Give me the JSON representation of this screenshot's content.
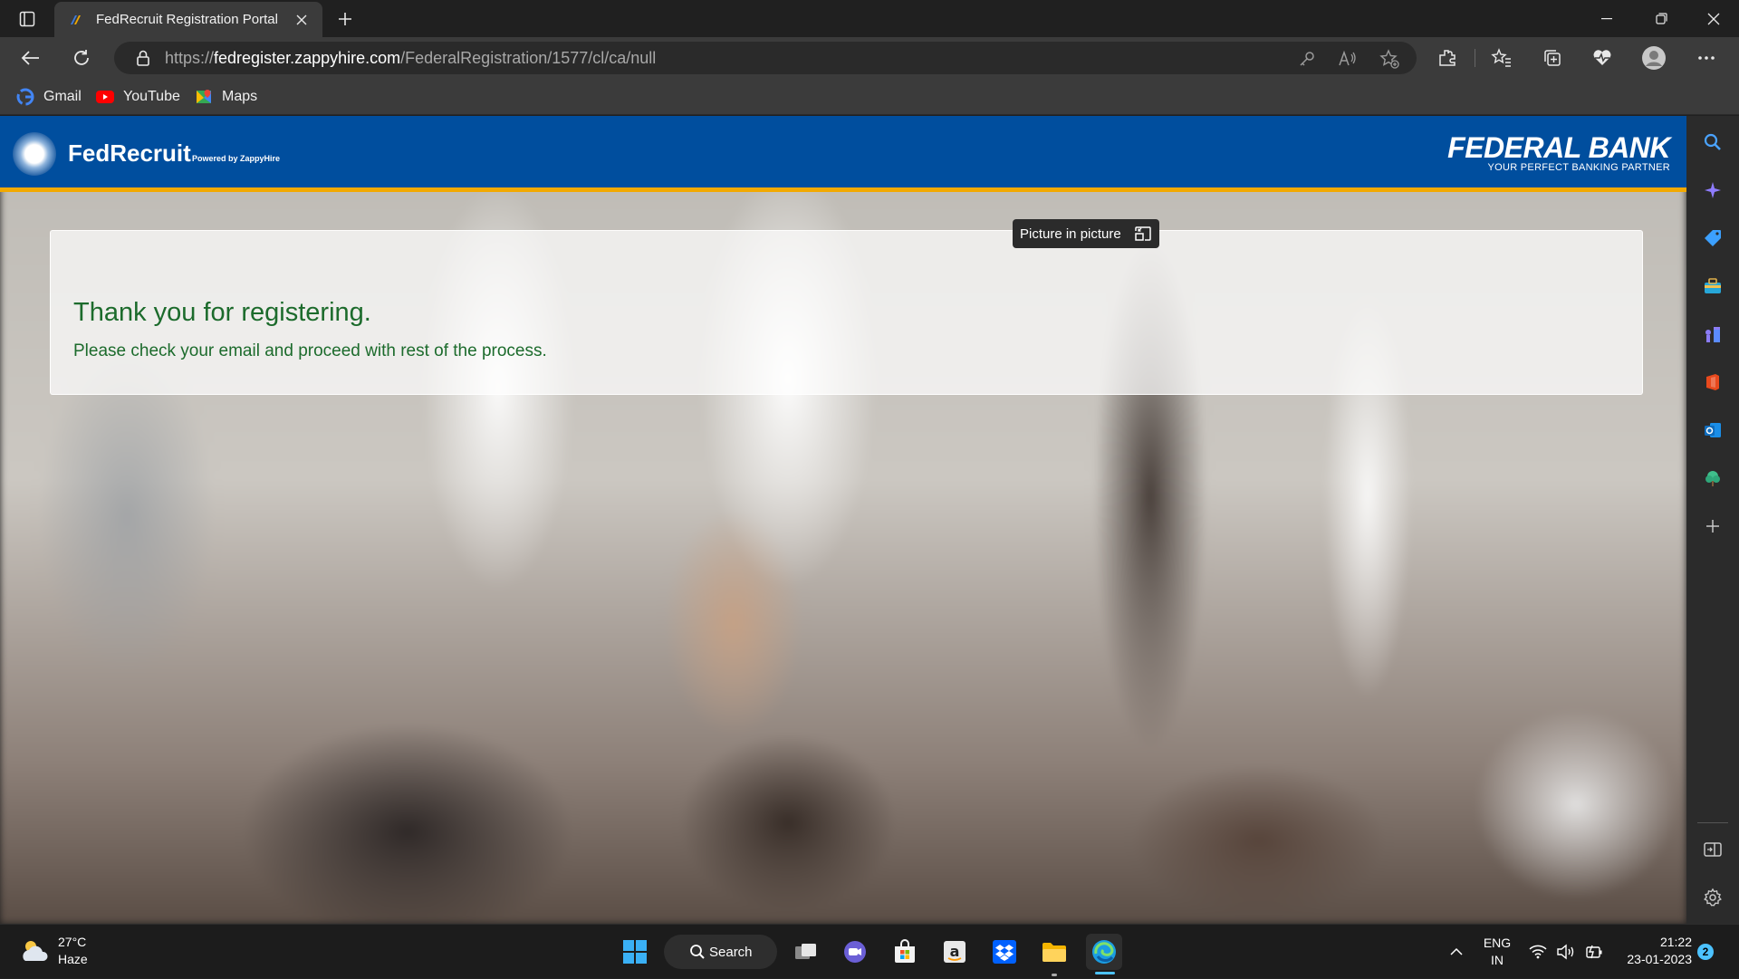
{
  "browser": {
    "tab_title": "FedRecruit Registration Portal",
    "url_prefix": "https://",
    "url_host": "fedregister.zappyhire.com",
    "url_path": "/FederalRegistration/1577/cl/ca/null",
    "bookmarks": [
      "Gmail",
      "YouTube",
      "Maps"
    ]
  },
  "site": {
    "brand": "FedRecruit",
    "brand_sub": "Powered by ZappyHire",
    "bank_name": "FEDERAL BANK",
    "bank_tagline": "YOUR PERFECT BANKING PARTNER",
    "header_color": "#004e9e",
    "accent_color": "#f2a900"
  },
  "card": {
    "title": "Thank you for registering.",
    "message": "Please check your email and proceed with rest of the process.",
    "text_color": "#1c6b2c"
  },
  "tooltip": {
    "label": "Picture in picture"
  },
  "sidebar_icons": [
    "search-icon",
    "copilot-icon",
    "shopping-icon",
    "tools-icon",
    "games-icon",
    "office-icon",
    "outlook-icon",
    "tree-icon",
    "add-icon",
    "split-screen-icon",
    "settings-icon"
  ],
  "taskbar": {
    "temperature": "27°C",
    "weather_condition": "Haze",
    "search_label": "Search",
    "language_line1": "ENG",
    "language_line2": "IN",
    "time": "21:22",
    "date": "23-01-2023",
    "notification_count": "2"
  }
}
